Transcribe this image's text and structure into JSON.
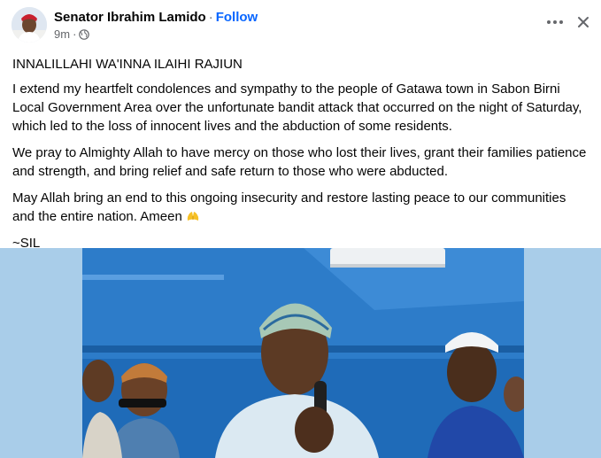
{
  "post": {
    "author": "Senator Ibrahim Lamido",
    "separator": "·",
    "follow_label": "Follow",
    "time": "9m",
    "visibility_icon": "globe-icon",
    "more_icon": "more-options-icon",
    "close_icon": "close-icon"
  },
  "content": {
    "heading": "INNALILLAHI WA'INNA ILAIHI RAJIUN",
    "para1": "I extend my heartfelt condolences and sympathy to the people of Gatawa town in Sabon Birni Local Government Area over the unfortunate bandit attack that occurred on the night of Saturday, which led to the loss of innocent lives and the abduction of some residents.",
    "para2": "We pray to Almighty Allah to have mercy on those who lost their lives, grant their families patience and strength, and bring relief and safe return to those who were abducted.",
    "para3": "May Allah bring an end to this ongoing insecurity and restore lasting peace to our communities and the entire nation. Ameen",
    "para3_emoji": "praying-hands-emoji",
    "signature": "~SIL"
  },
  "colors": {
    "accent": "#0866ff",
    "text": "#050505",
    "muted": "#65676b",
    "media_background": "#a9cde9"
  }
}
